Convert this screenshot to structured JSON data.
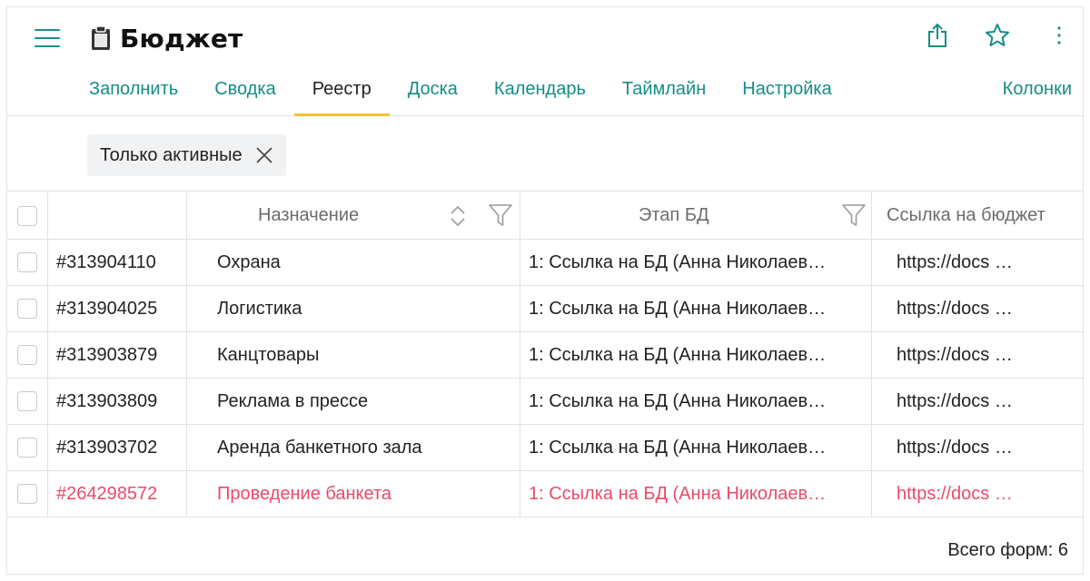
{
  "header": {
    "title": "Бюджет"
  },
  "tabs": [
    {
      "label": "Заполнить",
      "active": false
    },
    {
      "label": "Сводка",
      "active": false
    },
    {
      "label": "Реестр",
      "active": true
    },
    {
      "label": "Доска",
      "active": false
    },
    {
      "label": "Календарь",
      "active": false
    },
    {
      "label": "Таймлайн",
      "active": false
    },
    {
      "label": "Настройка",
      "active": false
    }
  ],
  "columns_button": "Колонки",
  "filter_chip": {
    "label": "Только активные"
  },
  "table": {
    "columns": {
      "purpose": "Назначение",
      "stage": "Этап БД",
      "link": "Ссылка на бюджет"
    },
    "rows": [
      {
        "id": "#313904110",
        "purpose": "Охрана",
        "stage": "1: Ссылка на БД (Анна Николаев…",
        "link": "https://docs …",
        "alert": false
      },
      {
        "id": "#313904025",
        "purpose": "Логистика",
        "stage": "1: Ссылка на БД (Анна Николаев…",
        "link": "https://docs …",
        "alert": false
      },
      {
        "id": "#313903879",
        "purpose": "Канцтовары",
        "stage": "1: Ссылка на БД (Анна Николаев…",
        "link": "https://docs …",
        "alert": false
      },
      {
        "id": "#313903809",
        "purpose": "Реклама в прессе",
        "stage": "1: Ссылка на БД (Анна Николаев…",
        "link": "https://docs …",
        "alert": false
      },
      {
        "id": "#313903702",
        "purpose": "Аренда банкетного зала",
        "stage": "1: Ссылка на БД (Анна Николаев…",
        "link": "https://docs …",
        "alert": false
      },
      {
        "id": "#264298572",
        "purpose": "Проведение банкета",
        "stage": "1: Ссылка на БД (Анна Николаев…",
        "link": "https://docs …",
        "alert": true
      }
    ]
  },
  "footer": {
    "total": "Всего форм: 6"
  },
  "icons": {
    "menu": "hamburger-icon",
    "title": "clipboard-icon",
    "share": "share-icon",
    "favorite": "star-icon",
    "more": "more-vertical-icon",
    "close": "close-icon",
    "sort": "sort-icon",
    "filter": "filter-icon"
  },
  "colors": {
    "accent": "#178c86",
    "active_tab_underline": "#f2c22e",
    "alert_row": "#ea4a6a"
  }
}
